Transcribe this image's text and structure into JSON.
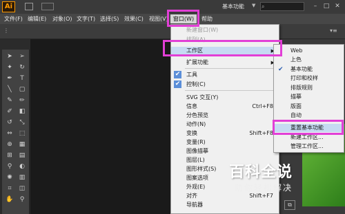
{
  "app": {
    "logo": "Ai",
    "workspace": "基本功能"
  },
  "menubar": {
    "items": [
      "文件(F)",
      "编辑(E)",
      "对象(O)",
      "文字(T)",
      "选择(S)",
      "效果(C)",
      "视图(V)",
      "窗口(W)",
      "帮助"
    ]
  },
  "window_menu": {
    "items": [
      {
        "label": "新建窗口(W)",
        "disabled": true
      },
      {
        "label": "排列(A)",
        "disabled": true
      },
      {
        "label": "工作区",
        "submenu": true
      },
      {
        "label": "扩展功能",
        "submenu": true
      },
      {
        "label": "工具",
        "checked": true
      },
      {
        "label": "控制(C)",
        "checked": true
      },
      {
        "label": "SVG 交互(Y)"
      },
      {
        "label": "信息",
        "shortcut": "Ctrl+F8"
      },
      {
        "label": "分色预览"
      },
      {
        "label": "动作(N)"
      },
      {
        "label": "变换",
        "shortcut": "Shift+F8"
      },
      {
        "label": "变量(R)"
      },
      {
        "label": "图像描摹"
      },
      {
        "label": "图层(L)"
      },
      {
        "label": "图形样式(S)"
      },
      {
        "label": "图案选项"
      },
      {
        "label": "外观(E)"
      },
      {
        "label": "对齐",
        "shortcut": "Shift+F7"
      },
      {
        "label": "导航器"
      }
    ]
  },
  "workspace_submenu": {
    "items": [
      {
        "label": "Web"
      },
      {
        "label": "上色"
      },
      {
        "label": "基本功能",
        "checked": true
      },
      {
        "label": "打印和校样"
      },
      {
        "label": "排版规则"
      },
      {
        "label": "描摹"
      },
      {
        "label": "版面"
      },
      {
        "label": "自动"
      },
      {
        "label": "重置基本功能",
        "highlighted": true
      },
      {
        "label": "新建工作区..."
      },
      {
        "label": "管理工作区..."
      }
    ]
  },
  "watermark": {
    "title": "百科全说",
    "subtitle": "助你轻松解决"
  },
  "colors": {
    "highlight_box": "#e23fd6",
    "checkbox": "#5b8ed8",
    "logo_orange": "#ff9a00"
  }
}
